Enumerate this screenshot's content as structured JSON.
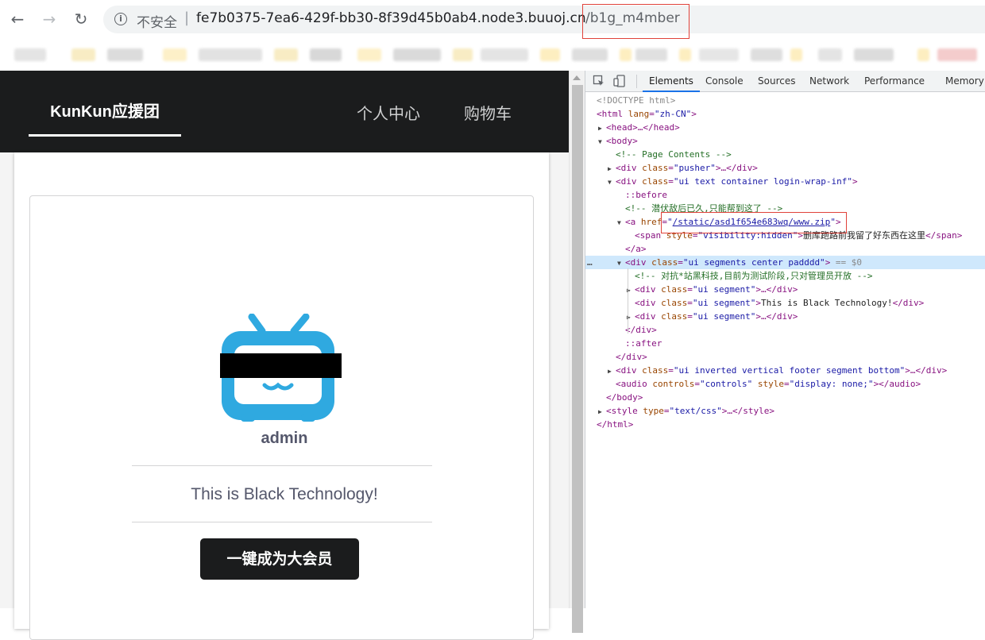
{
  "browser": {
    "back_icon": "←",
    "forward_icon": "→",
    "reload_icon": "↻",
    "info_icon": "i",
    "security_label": "不安全",
    "separator": "|",
    "url_host": "fe7b0375-7ea6-429f-bb30-8f39d45b0ab4.node3.buuoj.cn",
    "url_path": "/b1g_m4mber"
  },
  "site": {
    "brand": "KunKun应援团",
    "menu": [
      "个人中心",
      "购物车"
    ],
    "username": "admin",
    "tagline": "This is Black Technology!",
    "member_button": "一键成为大会员",
    "accent_color": "#2fa9e0"
  },
  "devtools": {
    "tabs": [
      "Elements",
      "Console",
      "Sources",
      "Network",
      "Performance",
      "Memory"
    ],
    "active_tab": "Elements",
    "tree": {
      "doctype": "<!DOCTYPE html>",
      "html_open": "<html",
      "html_lang_attr": " lang",
      "html_lang_val": "\"zh-CN\"",
      "head": "<head>…</head>",
      "body_open": "<body>",
      "comment_page": "<!-- Page Contents -->",
      "pusher_tag": "<div",
      "pusher_attr": " class",
      "pusher_val": "\"pusher\"",
      "pusher_close": ">…</div>",
      "container_tag": "<div",
      "container_attr": " class",
      "container_val": "\"ui text container login-wrap-inf\"",
      "before": "::before",
      "comment_lurk": "<!-- 潜伏敌后已久,只能帮到这了 -->",
      "a_tag": "<a",
      "a_attr": " href",
      "a_val": "/static/asd1f654e683wq/www.zip",
      "span_tag": "<span",
      "span_attr": " style",
      "span_val": "\"visibility:hidden\"",
      "span_text": "删库跑路前我留了好东西在这里",
      "span_close": "</span>",
      "a_close": "</a>",
      "segments_tag": "<div",
      "segments_attr": " class",
      "segments_val": "\"ui segments center padddd\"",
      "segments_marker": " == $0",
      "comment_tech": "<!-- 对抗*站黑科技,目前为测试阶段,只对管理员开放 -->",
      "segment_tag": "<div",
      "segment_attr": " class",
      "segment_val": "\"ui segment\"",
      "segment_close": ">…</div>",
      "segment_text": "This is Black Technology!",
      "div_close": "</div>",
      "after": "::after",
      "footer_val": "\"ui inverted vertical footer segment bottom\"",
      "audio_tag": "<audio",
      "audio_attr1": " controls",
      "audio_val1": "\"controls\"",
      "audio_attr2": " style",
      "audio_val2": "\"display: none;\"",
      "audio_close": "></audio>",
      "body_close": "</body>",
      "style_tag": "<style",
      "style_attr": " type",
      "style_val": "\"text/css\"",
      "style_close": ">…</style>",
      "html_close": "</html>",
      "dots": "…"
    }
  }
}
